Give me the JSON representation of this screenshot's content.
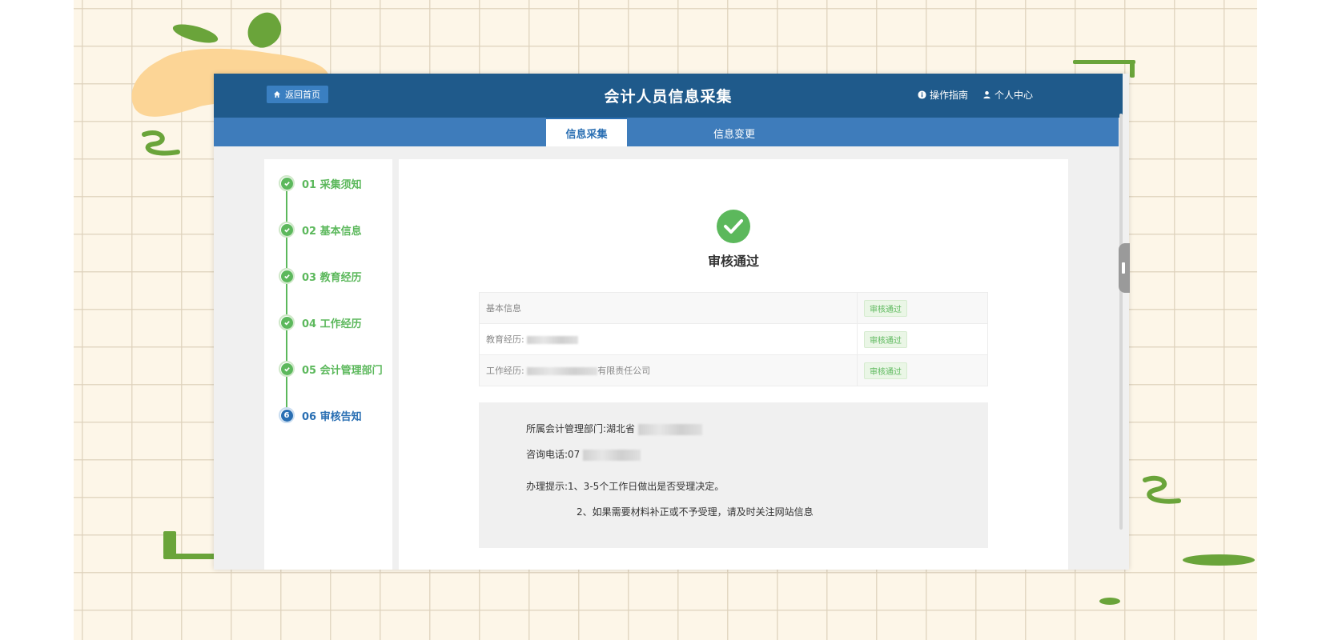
{
  "header": {
    "home_label": "返回首页",
    "title": "会计人员信息采集",
    "guide_label": "操作指南",
    "profile_label": "个人中心"
  },
  "tabs": [
    {
      "label": "信息采集",
      "active": true
    },
    {
      "label": "信息变更",
      "active": false
    }
  ],
  "steps": [
    {
      "label": "01 采集须知",
      "status": "done"
    },
    {
      "label": "02 基本信息",
      "status": "done"
    },
    {
      "label": "03 教育经历",
      "status": "done"
    },
    {
      "label": "04 工作经历",
      "status": "done"
    },
    {
      "label": "05 会计管理部门",
      "status": "done"
    },
    {
      "label": "06 审核告知",
      "status": "current",
      "number": "6"
    }
  ],
  "result": {
    "status_title": "审核通过",
    "rows": [
      {
        "label": "基本信息",
        "status": "审核通过"
      },
      {
        "label": "教育经历:",
        "status": "审核通过"
      },
      {
        "label": "工作经历:",
        "suffix": "有限责任公司",
        "status": "审核通过"
      }
    ]
  },
  "info": {
    "dept_label": "所属会计管理部门:",
    "dept_value": "湖北省",
    "phone_label": "咨询电话:",
    "phone_value": "07",
    "tips_label": "办理提示:",
    "tip1": "1、3-5个工作日做出是否受理决定。",
    "tip2": "2、如果需要材料补正或不予受理，请及时关注网站信息"
  },
  "colors": {
    "header_bg": "#1f5a8b",
    "tab_bg": "#3e7cbb",
    "success": "#5cb85c",
    "accent": "#2a6fb3"
  }
}
